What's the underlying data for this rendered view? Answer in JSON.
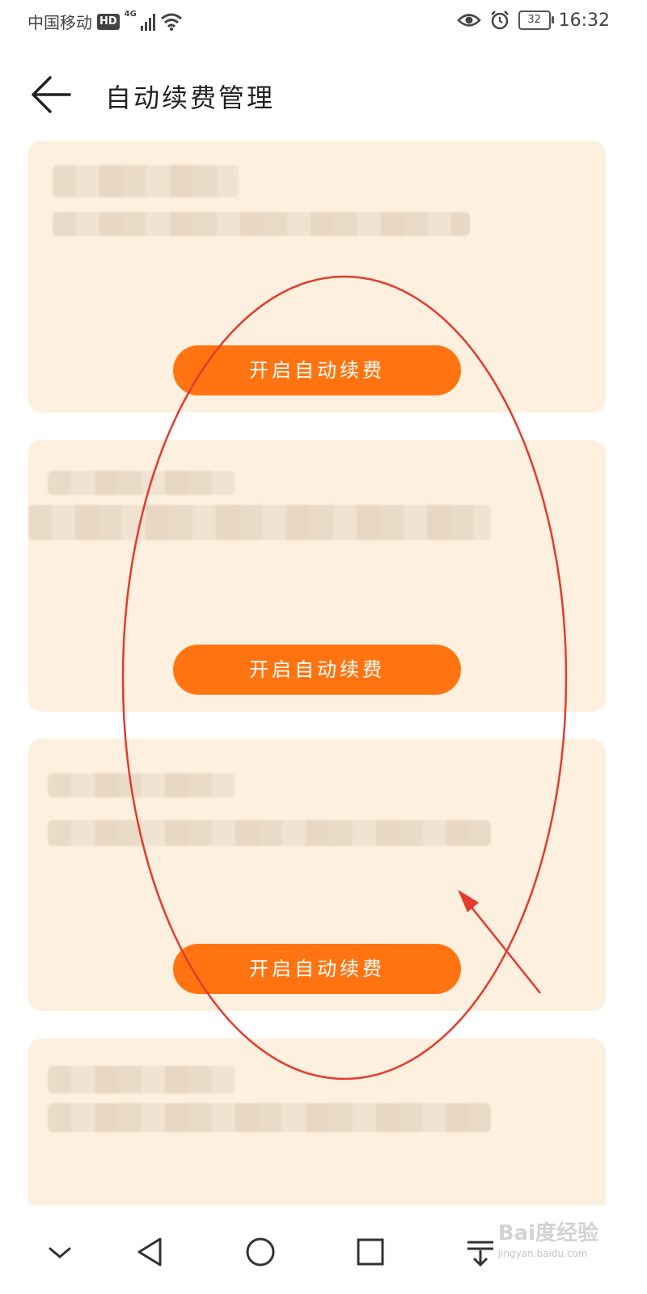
{
  "status_bar": {
    "carrier": "中国移动",
    "hd_badge": "HD",
    "network": "4G",
    "battery": "32",
    "time": "16:32"
  },
  "header": {
    "title": "自动续费管理"
  },
  "cards": [
    {
      "button_label": "开启自动续费"
    },
    {
      "button_label": "开启自动续费"
    },
    {
      "button_label": "开启自动续费"
    }
  ],
  "watermark": {
    "brand": "Bai度经验",
    "url": "jingyan.baidu.com"
  },
  "colors": {
    "accent": "#ff7411",
    "card_bg": "#fdf0de",
    "annotation": "#e53a2e"
  },
  "icons": [
    "back-arrow-icon",
    "eye-icon",
    "alarm-icon",
    "wifi-icon",
    "chevron-down-icon",
    "nav-back-icon",
    "nav-home-icon",
    "nav-recent-icon",
    "nav-pulldown-icon"
  ]
}
